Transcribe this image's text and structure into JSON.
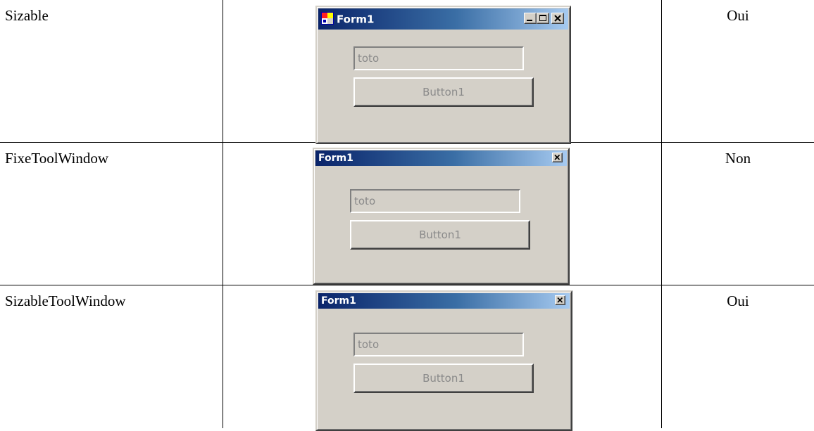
{
  "rows": [
    {
      "style": "Sizable",
      "value": "Oui",
      "form": {
        "title": "Form1",
        "titlebar_type": "standard",
        "buttons": [
          "minimize-icon",
          "maximize-icon",
          "close-icon"
        ],
        "textbox_value": "toto",
        "button_label": "Button1"
      }
    },
    {
      "style": "FixeToolWindow",
      "value": "Non",
      "form": {
        "title": "Form1",
        "titlebar_type": "tool",
        "buttons": [
          "close-icon"
        ],
        "textbox_value": "toto",
        "button_label": "Button1"
      }
    },
    {
      "style": "SizableToolWindow",
      "value": "Oui",
      "form": {
        "title": "Form1",
        "titlebar_type": "tool",
        "buttons": [
          "close-icon"
        ],
        "textbox_value": "toto",
        "button_label": "Button1"
      }
    }
  ],
  "colors": {
    "form_face": "#d4d0c8",
    "title_gradient_start": "#0a246a",
    "title_gradient_end": "#a6caf0",
    "disabled_text": "#8a8a8a"
  }
}
